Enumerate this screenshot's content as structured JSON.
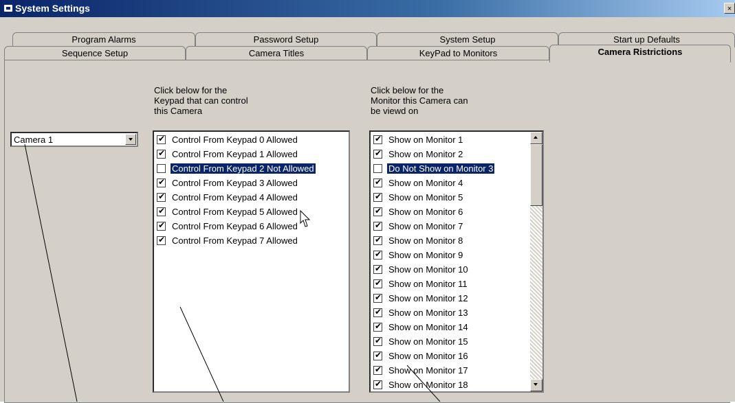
{
  "window": {
    "title": "System Settings"
  },
  "tabs_back": [
    "Program Alarms",
    "Password Setup",
    "System Setup",
    "Start up Defaults"
  ],
  "tabs_front": [
    "Sequence Setup",
    "Camera Titles",
    "KeyPad to Monitors",
    "Camera Ristrictions"
  ],
  "camera_select": {
    "value": "Camera 1"
  },
  "keypad_section": {
    "label": "Click below for the\nKeypad that can control\nthis Camera",
    "items": [
      {
        "label": "Control From Keypad 0 Allowed",
        "checked": true,
        "selected": false
      },
      {
        "label": "Control From Keypad 1 Allowed",
        "checked": true,
        "selected": false
      },
      {
        "label": "Control From Keypad 2 Not Allowed",
        "checked": false,
        "selected": true
      },
      {
        "label": "Control From Keypad 3 Allowed",
        "checked": true,
        "selected": false
      },
      {
        "label": "Control From Keypad 4 Allowed",
        "checked": true,
        "selected": false
      },
      {
        "label": "Control From Keypad 5 Allowed",
        "checked": true,
        "selected": false
      },
      {
        "label": "Control From Keypad 6 Allowed",
        "checked": true,
        "selected": false
      },
      {
        "label": "Control From Keypad 7 Allowed",
        "checked": true,
        "selected": false
      }
    ]
  },
  "monitor_section": {
    "label": "Click below for the\nMonitor this Camera can\nbe viewd on",
    "items": [
      {
        "label": "Show on Monitor 1",
        "checked": true,
        "selected": false
      },
      {
        "label": "Show on Monitor 2",
        "checked": true,
        "selected": false
      },
      {
        "label": "Do Not Show on Monitor 3",
        "checked": false,
        "selected": true
      },
      {
        "label": "Show on Monitor 4",
        "checked": true,
        "selected": false
      },
      {
        "label": "Show on Monitor 5",
        "checked": true,
        "selected": false
      },
      {
        "label": "Show on Monitor 6",
        "checked": true,
        "selected": false
      },
      {
        "label": "Show on Monitor 7",
        "checked": true,
        "selected": false
      },
      {
        "label": "Show on Monitor 8",
        "checked": true,
        "selected": false
      },
      {
        "label": "Show on Monitor 9",
        "checked": true,
        "selected": false
      },
      {
        "label": "Show on Monitor 10",
        "checked": true,
        "selected": false
      },
      {
        "label": "Show on Monitor 11",
        "checked": true,
        "selected": false
      },
      {
        "label": "Show on Monitor 12",
        "checked": true,
        "selected": false
      },
      {
        "label": "Show on Monitor 13",
        "checked": true,
        "selected": false
      },
      {
        "label": "Show on Monitor 14",
        "checked": true,
        "selected": false
      },
      {
        "label": "Show on Monitor 15",
        "checked": true,
        "selected": false
      },
      {
        "label": "Show on Monitor 16",
        "checked": true,
        "selected": false
      },
      {
        "label": "Show on Monitor 17",
        "checked": true,
        "selected": false
      },
      {
        "label": "Show on Monitor 18",
        "checked": true,
        "selected": false
      }
    ]
  },
  "icons": {
    "window": "window-icon",
    "close": "close-icon",
    "dropdown": "chevron-down-icon",
    "scroll_up": "arrow-up-icon",
    "scroll_down": "arrow-down-icon",
    "cursor": "mouse-cursor-icon"
  }
}
